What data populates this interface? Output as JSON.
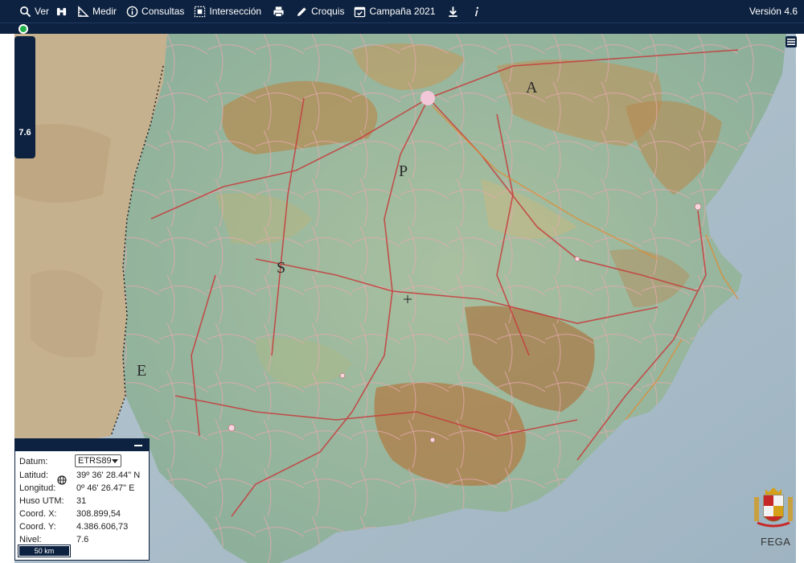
{
  "toolbar": {
    "items": [
      {
        "label": "Ver",
        "icon": "search-icon"
      },
      {
        "label": "",
        "icon": "binoculars-icon"
      },
      {
        "label": "Medir",
        "icon": "ruler-icon"
      },
      {
        "label": "Consultas",
        "icon": "info-icon"
      },
      {
        "label": "Intersección",
        "icon": "intersection-icon"
      },
      {
        "label": "",
        "icon": "print-icon"
      },
      {
        "label": "Croquis",
        "icon": "pencil-icon"
      },
      {
        "label": "Campaña 2021",
        "icon": "calendar-check-icon"
      },
      {
        "label": "",
        "icon": "download-icon"
      },
      {
        "label": "",
        "icon": "italic-info-icon"
      }
    ],
    "version": "Versión 4.6"
  },
  "status": {
    "indicator_color": "#20b04a"
  },
  "zoom": {
    "level": "7.6"
  },
  "map": {
    "letters": [
      "E",
      "S",
      "P",
      "A",
      "E"
    ],
    "colors": {
      "sea": "#c9d6dc",
      "land_low": "#8fb3a0",
      "land_mid": "#c9b77d",
      "mountain": "#b4874c",
      "foreign": "#c8b596",
      "road_red": "#c93a3a",
      "road_pink": "#f3c0c0"
    }
  },
  "info": {
    "datum_label": "Datum:",
    "datum_value": "ETRS89",
    "lat_label": "Latitud:",
    "lat_value": "39º 36' 28.44\" N",
    "lon_label": "Longitud:",
    "lon_value": "0º 46' 26.47\" E",
    "huso_label": "Huso UTM:",
    "huso_value": "31",
    "x_label": "Coord. X:",
    "x_value": "308.899,54",
    "y_label": "Coord. Y:",
    "y_value": "4.386.606,73",
    "nivel_label": "Nivel:",
    "nivel_value": "7.6",
    "scale": "50 km"
  },
  "brand": {
    "text": "FEGA"
  }
}
